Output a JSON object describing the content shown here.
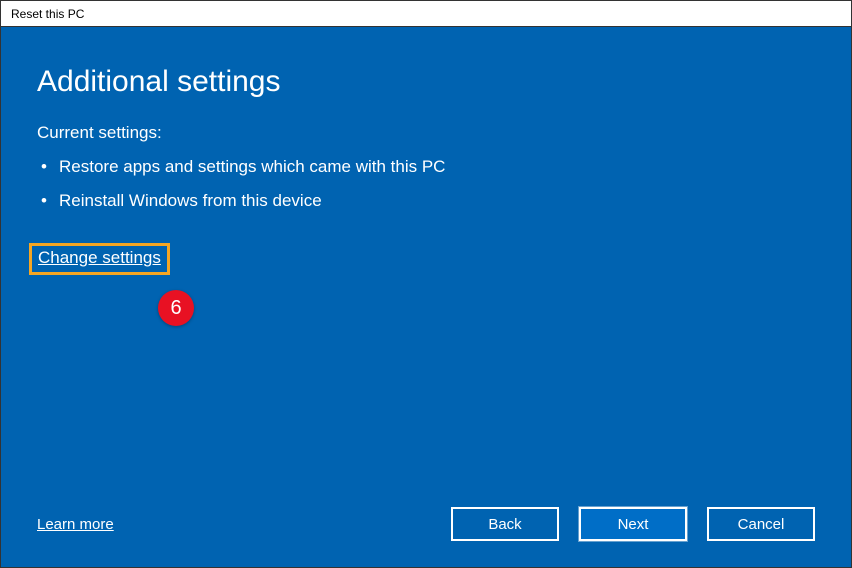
{
  "window": {
    "title": "Reset this PC"
  },
  "main": {
    "heading": "Additional settings",
    "subheading": "Current settings:",
    "bullets": [
      "Restore apps and settings which came with this PC",
      "Reinstall Windows from this device"
    ],
    "change_link": "Change settings"
  },
  "annotation": {
    "step": "6"
  },
  "footer": {
    "learn_more": "Learn more",
    "back": "Back",
    "next": "Next",
    "cancel": "Cancel"
  }
}
